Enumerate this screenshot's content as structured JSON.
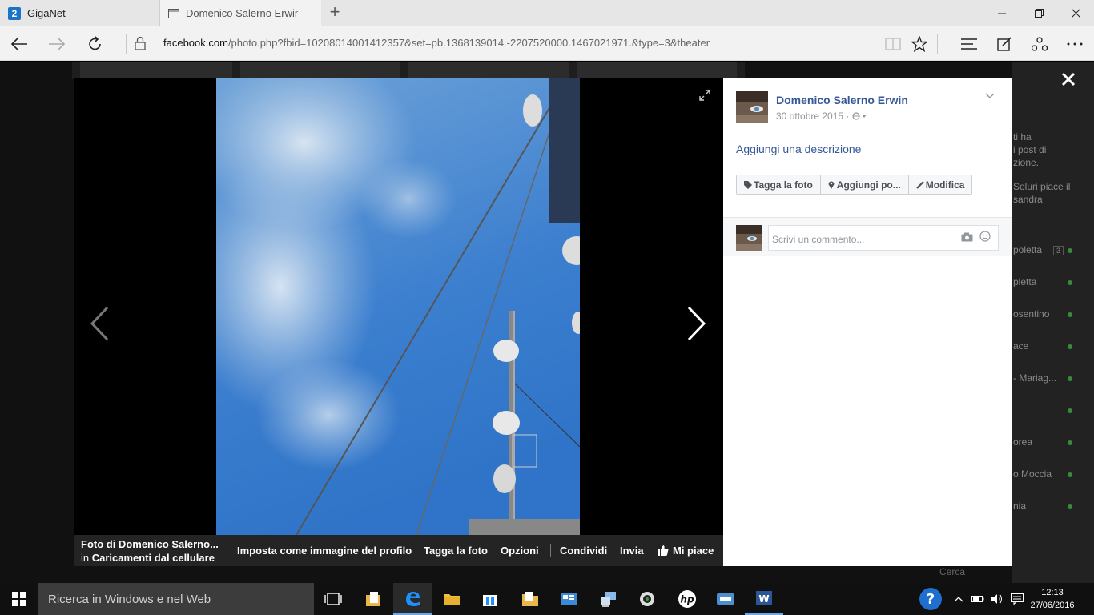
{
  "browser": {
    "tabs": [
      {
        "title": "GigaNet",
        "badge": "2"
      },
      {
        "title": "Domenico Salerno Erwin"
      }
    ],
    "url_host": "facebook.com",
    "url_path": "/photo.php?fbid=10208014001412357&set=pb.1368139014.-2207520000.1467021971.&type=3&theater",
    "icons": [
      "back-icon",
      "forward-icon",
      "refresh-icon",
      "lock-icon",
      "reading-view-icon",
      "favorite-star-icon",
      "hub-icon",
      "web-note-icon",
      "share-icon",
      "more-icon"
    ]
  },
  "photo": {
    "caption_title": "Foto di Domenico Salerno...",
    "caption_in": "in",
    "caption_album": "Caricamenti dal cellulare",
    "actions": [
      "Imposta come immagine del profilo",
      "Tagga la foto",
      "Opzioni",
      "Condividi",
      "Invia",
      "Mi piace"
    ]
  },
  "panel": {
    "author": "Domenico Salerno Erwin",
    "date": "30 ottobre 2015 ·",
    "add_description": "Aggiungi una descrizione",
    "buttons": [
      "Tagga la foto",
      "Aggiungi po...",
      "Modifica"
    ],
    "comment_placeholder": "Scrivi un commento..."
  },
  "background_sidebar": {
    "texts": [
      "ti ha",
      "i post di",
      "zione.",
      "Soluri piace il",
      "sandra",
      "poletta",
      "pletta",
      "osentino",
      "ace",
      "- Mariag...",
      "orea",
      "o Moccia",
      "nia",
      "Cerca"
    ],
    "badge": "3"
  },
  "taskbar": {
    "search_placeholder": "Ricerca in Windows e nel Web",
    "time": "12:13",
    "date": "27/06/2016",
    "accent": "#1e90ff"
  }
}
